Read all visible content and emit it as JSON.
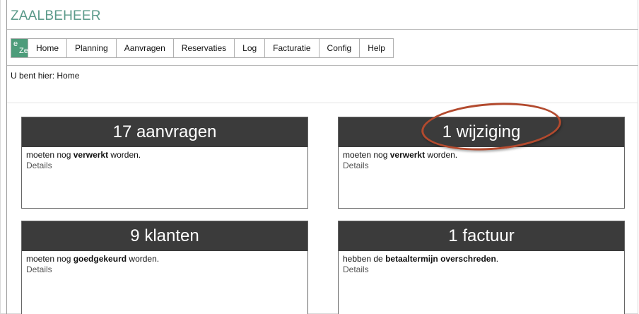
{
  "app_title": "ZAALBEHEER",
  "logo": {
    "line1": "e",
    "line2": "Ze"
  },
  "nav": [
    "Home",
    "Planning",
    "Aanvragen",
    "Reservaties",
    "Log",
    "Facturatie",
    "Config",
    "Help"
  ],
  "breadcrumb": "U bent hier: Home",
  "cards": [
    {
      "title": "17 aanvragen",
      "pre": "moeten nog ",
      "bold": "verwerkt",
      "post": " worden.",
      "details": "Details"
    },
    {
      "title": "1 wijziging",
      "pre": "moeten nog ",
      "bold": "verwerkt",
      "post": " worden.",
      "details": "Details"
    },
    {
      "title": "9 klanten",
      "pre": "moeten nog ",
      "bold": "goedgekeurd",
      "post": " worden.",
      "details": "Details"
    },
    {
      "title": "1 factuur",
      "pre": "hebben de ",
      "bold": "betaaltermijn overschreden",
      "post": ".",
      "details": "Details"
    }
  ],
  "colors": {
    "title": "#5b9a8a",
    "card_header": "#3b3b3b",
    "highlight": "#b34a2e",
    "logo": "#4d9c7a"
  }
}
